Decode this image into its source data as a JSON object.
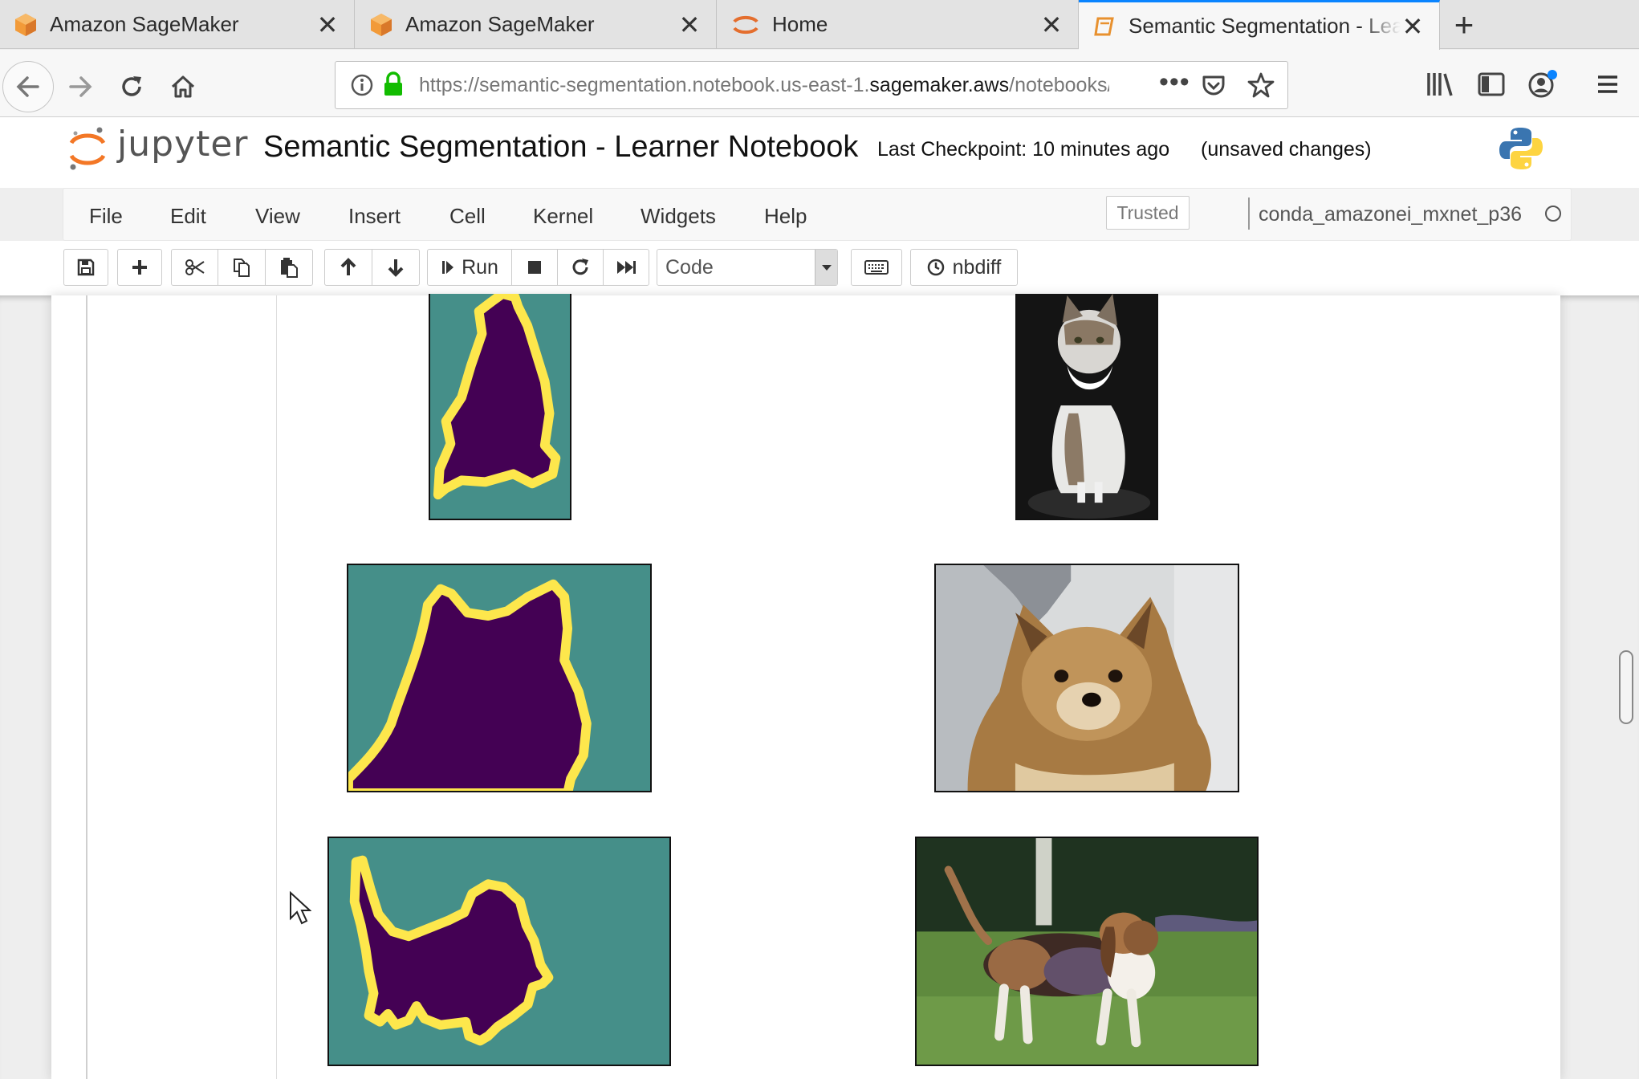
{
  "browser": {
    "tabs": [
      {
        "title": "Amazon SageMaker",
        "icon": "sagemaker-cube-icon"
      },
      {
        "title": "Amazon SageMaker",
        "icon": "sagemaker-cube-icon"
      },
      {
        "title": "Home",
        "icon": "jupyter-icon"
      },
      {
        "title": "Semantic Segmentation - Learner Notebook",
        "icon": "notebook-icon"
      }
    ],
    "url_prefix": "https://semantic-segmentation.notebook.us-east-1.",
    "url_domain": "sagemaker.aws",
    "url_suffix": "/notebooks/Semantic Segmentation - Learner Notebook.ipynb"
  },
  "jupyter": {
    "logo_text": "jupyter",
    "notebook_title": "Semantic Segmentation - Learner Notebook",
    "checkpoint": "Last Checkpoint: 10 minutes ago",
    "unsaved": "(unsaved changes)",
    "menu": [
      "File",
      "Edit",
      "View",
      "Insert",
      "Cell",
      "Kernel",
      "Widgets",
      "Help"
    ],
    "trusted": "Trusted",
    "kernel": "conda_amazonei_mxnet_p36",
    "toolbar": {
      "run_label": "Run",
      "cell_type": "Code",
      "nbdiff_label": "nbdiff"
    }
  },
  "colors": {
    "mask_background": "#458f89",
    "mask_object": "#440154",
    "mask_outline": "#fde74c",
    "tab_active_accent": "#0a84ff"
  }
}
